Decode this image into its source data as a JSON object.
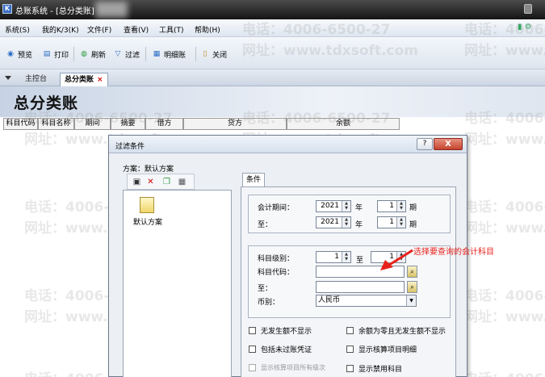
{
  "window": {
    "title": "总账系统 - [总分类账]"
  },
  "menubar": {
    "items": [
      "系统(S)",
      "我的K/3(K)",
      "文件(F)",
      "查看(V)",
      "工具(T)",
      "帮助(H)"
    ]
  },
  "toolbar": {
    "preview": "预览",
    "print": "打印",
    "refresh": "刷新",
    "filter": "过滤",
    "detail": "明细账",
    "close": "关闭"
  },
  "tabs": {
    "items": [
      {
        "label": "主控台",
        "active": false
      },
      {
        "label": "总分类账",
        "active": true
      }
    ],
    "close_glyph": "×"
  },
  "report": {
    "title": "总分类账",
    "columns": [
      "科目代码",
      "科目名称",
      "期间",
      "摘要",
      "借方",
      "贷方",
      "余额"
    ]
  },
  "watermark": {
    "phone": "电话：4006-6500-27",
    "site": "网址：www.tdxsoft.com"
  },
  "dialog": {
    "title": "过滤条件",
    "help_glyph": "?",
    "close_glyph": "X",
    "scheme_label": "方案：默认方案",
    "scheme_item": "默认方案",
    "tab_condition": "条件",
    "period_label": "会计期间：",
    "to_label": "至：",
    "year_unit": "年",
    "period_unit": "期",
    "period_from": {
      "year": "2021",
      "period": "1"
    },
    "period_to": {
      "year": "2021",
      "period": "1"
    },
    "level_label": "科目级别：",
    "level_to": "至",
    "level_from_value": "1",
    "level_to_value": "1",
    "code_label": "科目代码：",
    "code_to_label": "至：",
    "code_from_value": "",
    "code_to_value": "",
    "currency_label": "币别：",
    "currency_value": "人民币",
    "options": [
      {
        "label": "无发生额不显示",
        "checked": false,
        "enabled": true
      },
      {
        "label": "余额为零且无发生额不显示",
        "checked": false,
        "enabled": true
      },
      {
        "label": "包括未过账凭证",
        "checked": false,
        "enabled": true
      },
      {
        "label": "显示核算项目明细",
        "checked": false,
        "enabled": true
      },
      {
        "label": "显示核算项目所有级次",
        "checked": false,
        "enabled": false
      },
      {
        "label": "显示禁用科目",
        "checked": false,
        "enabled": true
      }
    ]
  },
  "annotation": {
    "text": "选择要查询的会计科目",
    "color": "#e8211b"
  }
}
